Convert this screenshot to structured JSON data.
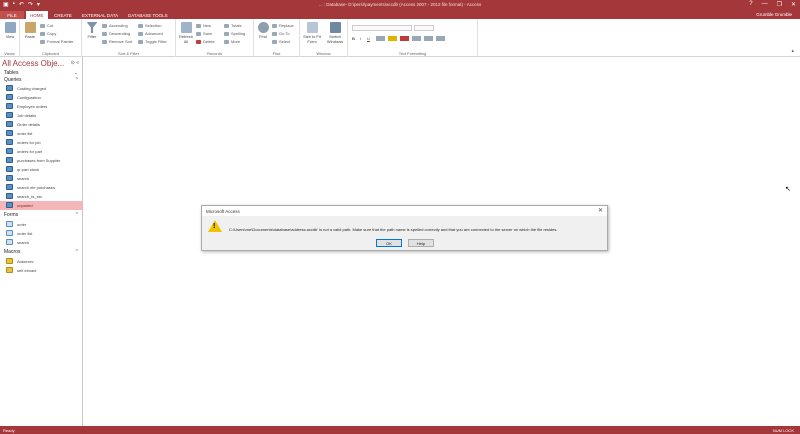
{
  "titlebar": {
    "title": "... : Database- D:\\pers\\\\payments\\accdb (Access 2007 - 2013 file format) - Access",
    "qa_icons": [
      "access-logo-icon",
      "save-icon",
      "undo-icon",
      "redo-icon"
    ],
    "win_controls": [
      "?",
      "—",
      "❐",
      "✕"
    ]
  },
  "tabs": {
    "file": "FILE",
    "items": [
      "HOME",
      "CREATE",
      "EXTERNAL DATA",
      "DATABASE TOOLS"
    ],
    "signin": "Grumble Grumble"
  },
  "ribbon": {
    "views": {
      "view": "View",
      "label": "Views"
    },
    "clipboard": {
      "paste": "Paste",
      "cut": "Cut",
      "copy": "Copy",
      "format_painter": "Format Painter",
      "label": "Clipboard"
    },
    "sort_filter": {
      "filter": "Filter",
      "ascending": "Ascending",
      "descending": "Descending",
      "remove_sort": "Remove Sort",
      "selection": "Selection",
      "advanced": "Advanced",
      "toggle_filter": "Toggle Filter",
      "label": "Sort & Filter"
    },
    "records": {
      "refresh": "Refresh All",
      "new": "New",
      "save": "Save",
      "delete": "Delete",
      "totals": "Totals",
      "spelling": "Spelling",
      "more": "More",
      "label": "Records"
    },
    "find": {
      "find": "Find",
      "replace": "Replace",
      "goto": "Go To",
      "select": "Select",
      "label": "Find"
    },
    "window": {
      "size_to_fit": "Size to Fit Form",
      "switch_windows": "Switch Windows",
      "label": "Window"
    },
    "text_formatting": {
      "bold": "B",
      "italic": "I",
      "underline": "U",
      "label": "Text Formatting"
    }
  },
  "nav": {
    "header": "All Access Obje...",
    "sections": {
      "tables": "Tables",
      "queries": "Queries",
      "forms": "Forms",
      "macros": "Macros"
    },
    "queries": [
      "Costing charged",
      "Configuration",
      "Employee orders",
      "Job details",
      "Order details",
      "order list",
      "orders for job",
      "orders for part",
      "purchases from Supplier",
      "qr part stock",
      "search",
      "search ele purchases",
      "search_ts_sto",
      "unpaired"
    ],
    "forms": [
      "order",
      "order list",
      "search"
    ],
    "macros": [
      "Autoexec",
      "self extract"
    ]
  },
  "dialog": {
    "title": "Microsoft Access",
    "message": "C:\\Users\\me\\Documents\\database\\address.accdb' is not a valid path. Make sure that the path name is spelled correctly and that you are connected to the server on which the file resides.",
    "ok": "OK",
    "help": "Help"
  },
  "status": {
    "left": "Ready",
    "right": "NUM LOCK"
  }
}
